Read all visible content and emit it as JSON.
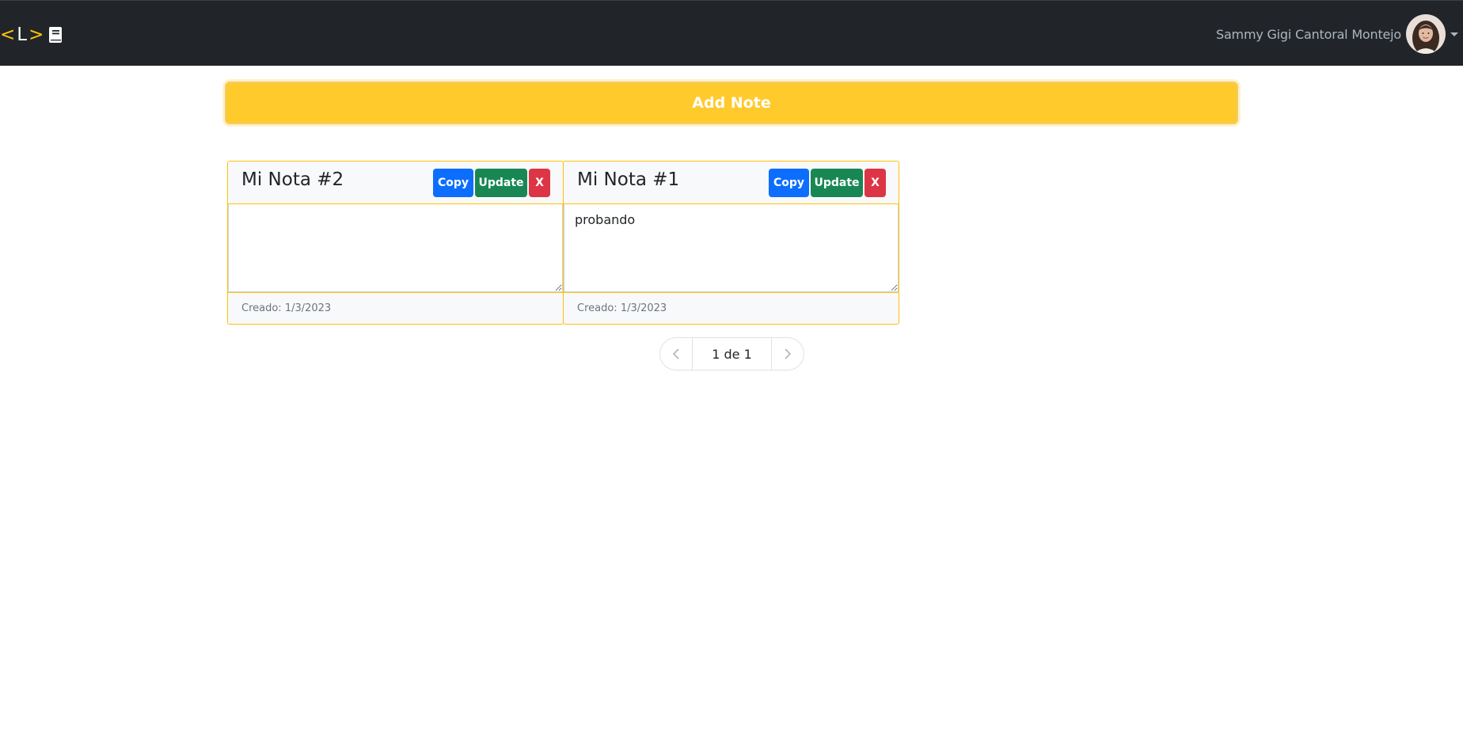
{
  "navbar": {
    "brand": {
      "lt": "<",
      "letter": "L",
      "gt": ">",
      "icon": "book-icon"
    },
    "user": {
      "name": "Sammy Gigi Cantoral Montejo",
      "avatar": "avatar",
      "menu_icon": "caret-down-icon"
    }
  },
  "actions": {
    "add_label": "Add Note"
  },
  "notes": [
    {
      "title": "Mi Nota #2",
      "content": "",
      "created": "Creado: 1/3/2023",
      "copy_label": "Copy",
      "update_label": "Update",
      "delete_label": "X"
    },
    {
      "title": "Mi Nota #1",
      "content": "probando",
      "created": "Creado: 1/3/2023",
      "copy_label": "Copy",
      "update_label": "Update",
      "delete_label": "X"
    }
  ],
  "pagination": {
    "page_text": "1 de 1",
    "prev_icon": "chevron-left-icon",
    "next_icon": "chevron-right-icon"
  },
  "colors": {
    "navbar": "#212529",
    "accent": "#ffc107",
    "add_button": "#ffca2c",
    "copy": "#0d6efd",
    "update": "#198754",
    "delete": "#dc3545"
  }
}
